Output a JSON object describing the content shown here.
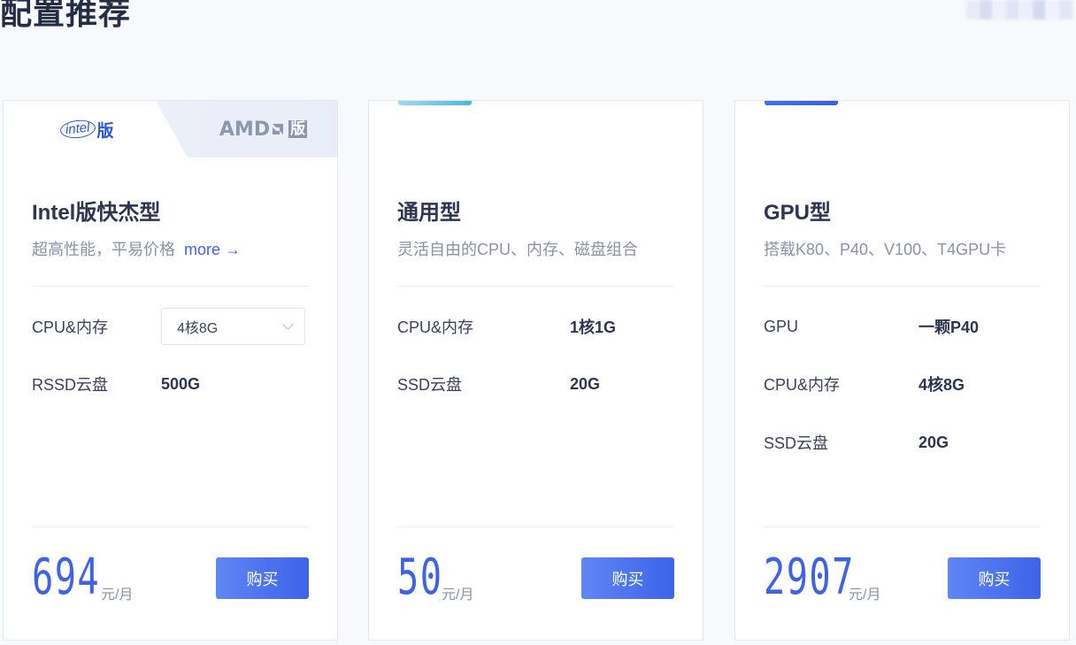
{
  "section": {
    "title": "配置推荐"
  },
  "deco": {
    "blur_colors": [
      "#e8ebf7",
      "#d7dcf1",
      "#eef0fa",
      "#dfe3f4",
      "#eceffa",
      "#d3d9f0",
      "#f0f2fb",
      "#e2e6f5"
    ]
  },
  "cards": [
    {
      "vendor_tabs": {
        "intel_logo": "intel",
        "intel_suffix": "版",
        "amd_logo": "AMD",
        "amd_suffix": "版",
        "active": "intel"
      },
      "title": "Intel版快杰型",
      "desc": "超高性能，平易价格",
      "more": "more →",
      "specs": [
        {
          "label": "CPU&内存",
          "value": "4核8G",
          "type": "select"
        },
        {
          "label": "RSSD云盘",
          "value": "500G"
        }
      ],
      "price": "694",
      "unit": "元/月",
      "buy": "购买"
    },
    {
      "title": "通用型",
      "desc": "灵活自由的CPU、内存、磁盘组合",
      "specs": [
        {
          "label": "CPU&内存",
          "value": "1核1G"
        },
        {
          "label": "SSD云盘",
          "value": "20G"
        }
      ],
      "price": "50",
      "unit": "元/月",
      "buy": "购买"
    },
    {
      "title": "GPU型",
      "desc": "搭载K80、P40、V100、T4GPU卡",
      "specs": [
        {
          "label": "GPU",
          "value": "一颗P40"
        },
        {
          "label": "CPU&内存",
          "value": "4核8G"
        },
        {
          "label": "SSD云盘",
          "value": "20G"
        }
      ],
      "price": "2907",
      "unit": "元/月",
      "buy": "购买"
    }
  ]
}
